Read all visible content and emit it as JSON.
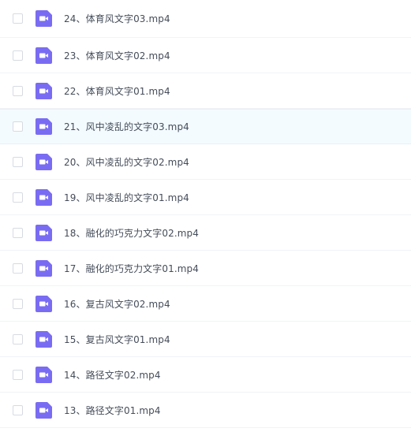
{
  "colors": {
    "icon_fill": "#7a6cf2",
    "icon_glyph": "#ffffff",
    "row_highlight": "#f4fbff",
    "text": "#454d5a"
  },
  "icons": {
    "file_type": "video-icon"
  },
  "files": [
    {
      "name": "24、体育风文字03.mp4",
      "highlighted": false
    },
    {
      "name": "23、体育风文字02.mp4",
      "highlighted": false
    },
    {
      "name": "22、体育风文字01.mp4",
      "highlighted": false
    },
    {
      "name": "21、风中凌乱的文字03.mp4",
      "highlighted": true
    },
    {
      "name": "20、风中凌乱的文字02.mp4",
      "highlighted": false
    },
    {
      "name": "19、风中凌乱的文字01.mp4",
      "highlighted": false
    },
    {
      "name": "18、融化的巧克力文字02.mp4",
      "highlighted": false
    },
    {
      "name": "17、融化的巧克力文字01.mp4",
      "highlighted": false
    },
    {
      "name": "16、复古风文字02.mp4",
      "highlighted": false
    },
    {
      "name": "15、复古风文字01.mp4",
      "highlighted": false
    },
    {
      "name": "14、路径文字02.mp4",
      "highlighted": false
    },
    {
      "name": "13、路径文字01.mp4",
      "highlighted": false
    }
  ]
}
